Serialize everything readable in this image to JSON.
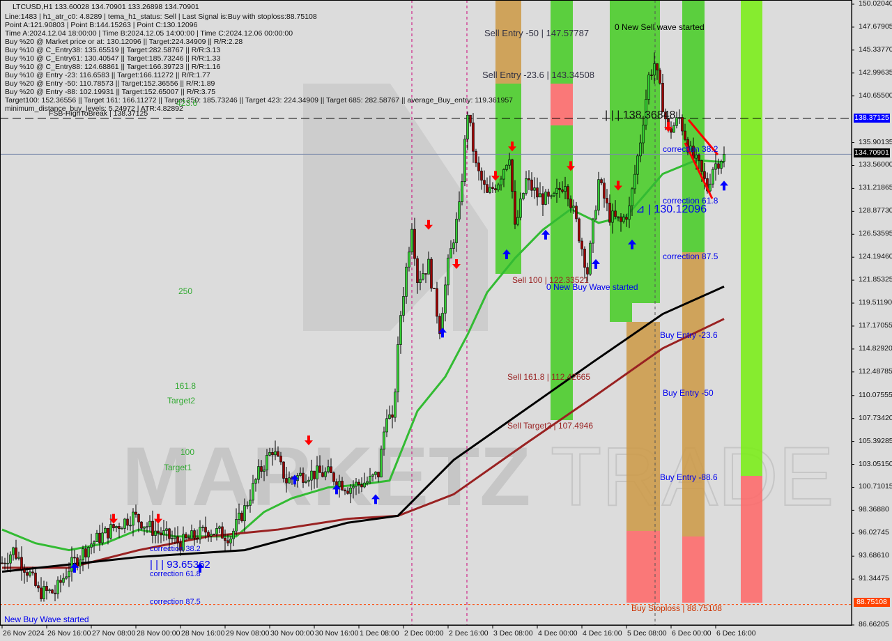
{
  "header": {
    "symbol_line": "LTCUSD,H1  133.60028 134.70901 133.26898 134.70901",
    "info_lines": [
      "Line:1483 | h1_atr_c0: 4.8289 | tema_h1_status: Sell | Last Signal is:Buy with stoploss:88.75108",
      "Point A:121.90803 | Point B:144.15263 | Point C:130.12096",
      "Time A:2024.12.04 18:00:00 | Time B:2024.12.05 14:00:00 | Time C:2024.12.06 00:00:00",
      "Buy %20 @ Market price or at: 130.12096 || Target:224.34909 || R/R:2.28",
      "Buy %10 @ C_Entry38: 135.65519 || Target:282.58767 || R/R:3.13",
      "Buy %10 @ C_Entry61: 130.40547 || Target:185.73246 || R/R:1.33",
      "Buy %10 @ C_Entry88: 124.68861 || Target:166.39723 || R/R:1.16",
      "Buy %10 @ Entry -23: 116.6583 || Target:166.11272 || R/R:1.77",
      "Buy %20 @ Entry -50: 110.78573 || Target:152.36556 || R/R:1.89",
      "Buy %20 @ Entry -88: 102.19931 || Target:152.65007 || R/R:3.75",
      "Target100: 152.36556 || Target 161: 166.11272 || Target 250: 185.73246 || Target 423: 224.34909 || Target 685: 282.58767 || average_Buy_entry: 119.361957",
      "minimum_distance_buy_levels: 5.24972 | ATR:4.82892"
    ]
  },
  "annotations": {
    "sell_entry_50": "Sell Entry -50 | 147.57787",
    "sell_entry_236": "Sell Entry -23.6 | 143.34508",
    "new_sell_wave": "0 New Sell wave started",
    "level_138": "| | | 138.36848",
    "correction_382_right": "correction 38.2",
    "correction_618_right": "correction 61.8",
    "level_130": "⊿ | 130.12096",
    "correction_875_right": "correction 87.5",
    "sell_100": "Sell 100 | 122.33521",
    "new_buy_wave_right": "0 New Buy Wave started",
    "buy_entry_236": "Buy Entry -23.6",
    "sell_1618": "Sell 161.8 | 112.42665",
    "buy_entry_50": "Buy Entry -50",
    "sell_target2": "Sell Target2 | 107.4946",
    "buy_entry_886": "Buy Entry -88.6",
    "buy_stoploss": "Buy Stoploss | 88.75108",
    "fib_4236": "423.6",
    "fsb_high": "FSB-HighToBreak | 138.37125",
    "fib_250": "250",
    "fib_1618": "161.8",
    "target2": "Target2",
    "fib_100": "100",
    "target1": "Target1",
    "correction_382_left": "correction 38.2",
    "level_9365": "| | | 93.65362",
    "correction_618_left": "correction 61.8",
    "correction_875_left": "correction 87.5",
    "new_buy_wave_left": "New Buy Wave started",
    "watermark": "MARKETZITRADE"
  },
  "price_tags": {
    "fsb": "138.37125",
    "current": "134.70901",
    "stoploss": "88.75108"
  },
  "colors": {
    "background": "#dcdcdc",
    "bull": "#33cc33",
    "bear": "#990000",
    "ma_fast": "#33bb33",
    "ma_mid": "#000000",
    "ma_slow": "#992222",
    "stoploss": "#ff4400",
    "fsb": "#0000ff",
    "zone_green": "#44cc22",
    "zone_sell": "#cc9944",
    "zone_red": "#ff6666"
  },
  "chart_data": {
    "type": "candlestick",
    "symbol": "LTCUSD",
    "timeframe": "H1",
    "ylim": [
      86.66205,
      150.0204
    ],
    "y_ticks": [
      "150.02040",
      "147.67905",
      "145.33770",
      "142.99635",
      "140.65500",
      "138.37125",
      "135.90135",
      "133.56000",
      "131.21865",
      "128.87730",
      "126.53595",
      "124.19460",
      "121.85325",
      "119.51190",
      "117.17055",
      "114.82920",
      "112.48785",
      "110.07555",
      "107.73420",
      "105.39285",
      "103.05150",
      "100.71015",
      "98.36880",
      "96.02745",
      "93.68610",
      "91.34475",
      "88.75108",
      "86.66205"
    ],
    "x_ticks": [
      "26 Nov 2024",
      "26 Nov 16:00",
      "27 Nov 08:00",
      "28 Nov 00:00",
      "28 Nov 16:00",
      "29 Nov 08:00",
      "30 Nov 00:00",
      "30 Nov 16:00",
      "1 Dec 08:00",
      "2 Dec 00:00",
      "2 Dec 16:00",
      "3 Dec 08:00",
      "4 Dec 00:00",
      "4 Dec 16:00",
      "5 Dec 08:00",
      "6 Dec 00:00",
      "6 Dec 16:00"
    ],
    "close_approx": [
      [
        0,
        93
      ],
      [
        4,
        94.3
      ],
      [
        10,
        91.8
      ],
      [
        13,
        90
      ],
      [
        19,
        90
      ],
      [
        24,
        92.5
      ],
      [
        32,
        95
      ],
      [
        39,
        96.4
      ],
      [
        47,
        97.8
      ],
      [
        54,
        96.4
      ],
      [
        64,
        95
      ],
      [
        74,
        96.4
      ],
      [
        82,
        95.7
      ],
      [
        87,
        98.5
      ],
      [
        92,
        102.1
      ],
      [
        97,
        104.6
      ],
      [
        102,
        101.4
      ],
      [
        109,
        102.1
      ],
      [
        117,
        102.1
      ],
      [
        124,
        100.7
      ],
      [
        132,
        101.4
      ],
      [
        135,
        102.1
      ],
      [
        138,
        108.5
      ],
      [
        140,
        107.1
      ],
      [
        143,
        118.4
      ],
      [
        147,
        127.7
      ],
      [
        149,
        122
      ],
      [
        153,
        123.4
      ],
      [
        157,
        117
      ],
      [
        160,
        123.4
      ],
      [
        164,
        129.1
      ],
      [
        167,
        139.1
      ],
      [
        170,
        133.4
      ],
      [
        174,
        130.5
      ],
      [
        178,
        132
      ],
      [
        182,
        134.8
      ],
      [
        184,
        127
      ],
      [
        188,
        132
      ],
      [
        192,
        130.5
      ],
      [
        197,
        129.8
      ],
      [
        202,
        132
      ],
      [
        206,
        127.7
      ],
      [
        210,
        122.7
      ],
      [
        214,
        132
      ],
      [
        218,
        128.4
      ],
      [
        222,
        127.7
      ],
      [
        225,
        129.1
      ],
      [
        229,
        136.2
      ],
      [
        232,
        142.6
      ],
      [
        234,
        144
      ],
      [
        237,
        139.8
      ],
      [
        239,
        136.9
      ],
      [
        243,
        138.4
      ],
      [
        247,
        134.8
      ],
      [
        250,
        133.4
      ],
      [
        253,
        131.2
      ],
      [
        255,
        133.4
      ],
      [
        259,
        134.70901
      ]
    ],
    "ma_black": [
      [
        0,
        92.1
      ],
      [
        49,
        93.6
      ],
      [
        87,
        94.3
      ],
      [
        124,
        97.1
      ],
      [
        142,
        97.8
      ],
      [
        162,
        103.5
      ],
      [
        187,
        108.5
      ],
      [
        212,
        113.5
      ],
      [
        237,
        118.4
      ],
      [
        259,
        121.2
      ]
    ],
    "ma_brown": [
      [
        0,
        92.5
      ],
      [
        24,
        92.5
      ],
      [
        49,
        94.3
      ],
      [
        74,
        95.7
      ],
      [
        99,
        96.4
      ],
      [
        124,
        97.5
      ],
      [
        142,
        97.8
      ],
      [
        162,
        100
      ],
      [
        187,
        105
      ],
      [
        212,
        109.9
      ],
      [
        237,
        114.9
      ],
      [
        259,
        117.9
      ]
    ],
    "ma_green": [
      [
        0,
        96.4
      ],
      [
        12,
        95
      ],
      [
        24,
        94.3
      ],
      [
        37,
        95
      ],
      [
        49,
        96.4
      ],
      [
        62,
        95.7
      ],
      [
        84,
        95.7
      ],
      [
        94,
        98.2
      ],
      [
        104,
        99.6
      ],
      [
        117,
        100.7
      ],
      [
        129,
        101
      ],
      [
        139,
        101.4
      ],
      [
        149,
        108.5
      ],
      [
        159,
        112
      ],
      [
        167,
        116.3
      ],
      [
        174,
        120.6
      ],
      [
        184,
        124.1
      ],
      [
        194,
        127
      ],
      [
        204,
        129.1
      ],
      [
        214,
        127.7
      ],
      [
        224,
        128.4
      ],
      [
        237,
        132.7
      ],
      [
        249,
        134.1
      ],
      [
        259,
        133.9
      ]
    ],
    "horizontal_levels": {
      "fsb_high": 138.37125,
      "current": 134.70901,
      "stoploss": 88.75108
    },
    "signals": [
      [
        26,
        93,
        "buy"
      ],
      [
        40,
        97,
        "sell"
      ],
      [
        56,
        97,
        "sell"
      ],
      [
        71,
        93,
        "buy"
      ],
      [
        105,
        102,
        "buy"
      ],
      [
        110,
        105,
        "sell"
      ],
      [
        120,
        101,
        "buy"
      ],
      [
        134,
        100,
        "buy"
      ],
      [
        153,
        127,
        "sell"
      ],
      [
        158,
        117,
        "buy"
      ],
      [
        163,
        123,
        "sell"
      ],
      [
        177,
        132,
        "sell"
      ],
      [
        181,
        125,
        "buy"
      ],
      [
        183,
        135,
        "sell"
      ],
      [
        195,
        127,
        "buy"
      ],
      [
        204,
        133,
        "sell"
      ],
      [
        213,
        124,
        "buy"
      ],
      [
        221,
        131,
        "sell"
      ],
      [
        226,
        126,
        "buy"
      ],
      [
        239,
        137,
        "sell"
      ],
      [
        259,
        132,
        "buy"
      ]
    ]
  }
}
